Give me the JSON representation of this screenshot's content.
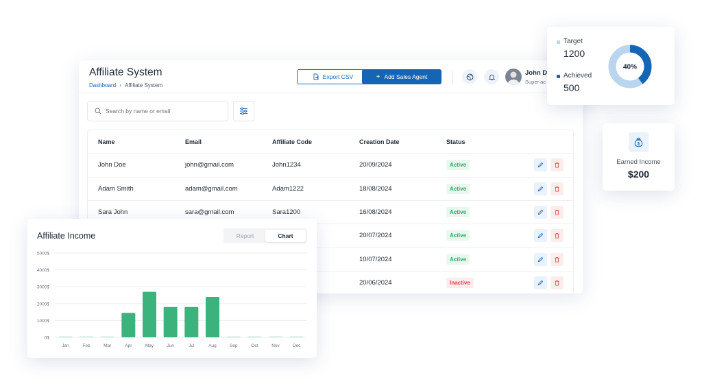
{
  "header": {
    "title": "Affiliate System",
    "breadcrumb": {
      "home": "Dashboard",
      "current": "Affiliate System"
    },
    "export_label": "Export CSV",
    "add_label": "Add Sales Agent",
    "user": {
      "name": "John D",
      "role": "Super ac"
    }
  },
  "search": {
    "placeholder": "Search by name or email"
  },
  "table": {
    "columns": [
      "Name",
      "Email",
      "Affiliate Code",
      "Creation Date",
      "Status"
    ],
    "rows": [
      {
        "name": "John Doe",
        "email": "john@gmail.com",
        "code": "John1234",
        "date": "20/09/2024",
        "status": "Active"
      },
      {
        "name": "Adam Smith",
        "email": "adam@gmail.com",
        "code": "Adam1222",
        "date": "18/08/2024",
        "status": "Active"
      },
      {
        "name": "Sara John",
        "email": "sara@gmail.com",
        "code": "Sara1200",
        "date": "16/08/2024",
        "status": "Active"
      },
      {
        "name": "",
        "email": "",
        "code": "",
        "date": "20/07/2024",
        "status": "Active"
      },
      {
        "name": "",
        "email": "",
        "code": "",
        "date": "10/07/2024",
        "status": "Active"
      },
      {
        "name": "",
        "email": "",
        "code": "",
        "date": "20/06/2024",
        "status": "Inactive"
      }
    ]
  },
  "income": {
    "title": "Affiliate Income",
    "tabs": {
      "report": "Report",
      "chart": "Chart"
    }
  },
  "chart_data": {
    "type": "bar",
    "title": "Affiliate Income",
    "categories": [
      "Jan",
      "Feb",
      "Mar",
      "Apr",
      "May",
      "Jun",
      "Jul",
      "Aug",
      "Sep",
      "Oct",
      "Nov",
      "Dec"
    ],
    "values": [
      0,
      0,
      0,
      1450,
      2700,
      1800,
      1800,
      2400,
      0,
      0,
      0,
      0
    ],
    "yticks": [
      "0$",
      "1000$",
      "2000$",
      "3000$",
      "4000$",
      "5000$"
    ],
    "ylim": [
      0,
      5000
    ],
    "grid": true,
    "bar_color": "#3cb27c"
  },
  "target_card": {
    "target_label": "Target",
    "target_value": "1200",
    "achieved_label": "Achieved",
    "achieved_value": "500",
    "percent_label": "40%",
    "achieved_fraction": 0.4,
    "colors": {
      "target": "#b9d6ee",
      "achieved": "#1565b5"
    }
  },
  "earned": {
    "label": "Earned Income",
    "value": "$200"
  },
  "colors": {
    "primary": "#1565b5",
    "active": "#2fa564",
    "inactive": "#e0414b"
  }
}
